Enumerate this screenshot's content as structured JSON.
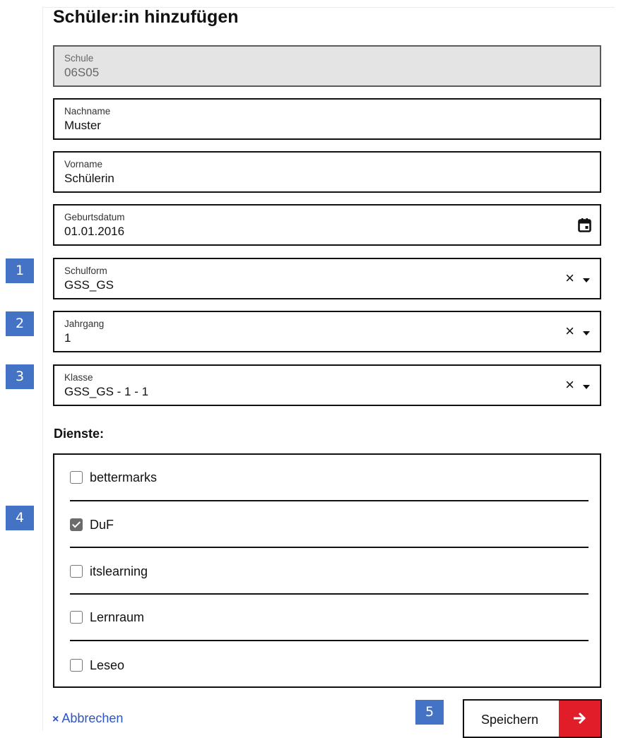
{
  "page": {
    "title": "Schüler:in hinzufügen"
  },
  "fields": {
    "schule": {
      "label": "Schule",
      "value": "06S05"
    },
    "nachname": {
      "label": "Nachname",
      "value": "Muster"
    },
    "vorname": {
      "label": "Vorname",
      "value": "Schülerin"
    },
    "geburtsdatum": {
      "label": "Geburtsdatum",
      "value": "01.01.2016",
      "icon": "calendar-icon"
    },
    "schulform": {
      "label": "Schulform",
      "value": "GSS_GS"
    },
    "jahrgang": {
      "label": "Jahrgang",
      "value": "1"
    },
    "klasse": {
      "label": "Klasse",
      "value": "GSS_GS - 1 - 1"
    }
  },
  "clear_glyph": "×",
  "markers": [
    "1",
    "2",
    "3",
    "4",
    "5"
  ],
  "services": {
    "heading": "Dienste:",
    "items": [
      {
        "label": "bettermarks",
        "checked": false
      },
      {
        "label": "DuF",
        "checked": true
      },
      {
        "label": "itslearning",
        "checked": false
      },
      {
        "label": "Lernraum",
        "checked": false
      },
      {
        "label": "Leseo",
        "checked": false
      }
    ]
  },
  "actions": {
    "cancel_icon": "×",
    "cancel_label": "Abbrechen",
    "save_label": "Speichern",
    "save_icon": "arrow-right-icon"
  },
  "colors": {
    "accent_red": "#e11d2a",
    "link_blue": "#2b54c7",
    "marker_blue": "#4472c4"
  }
}
